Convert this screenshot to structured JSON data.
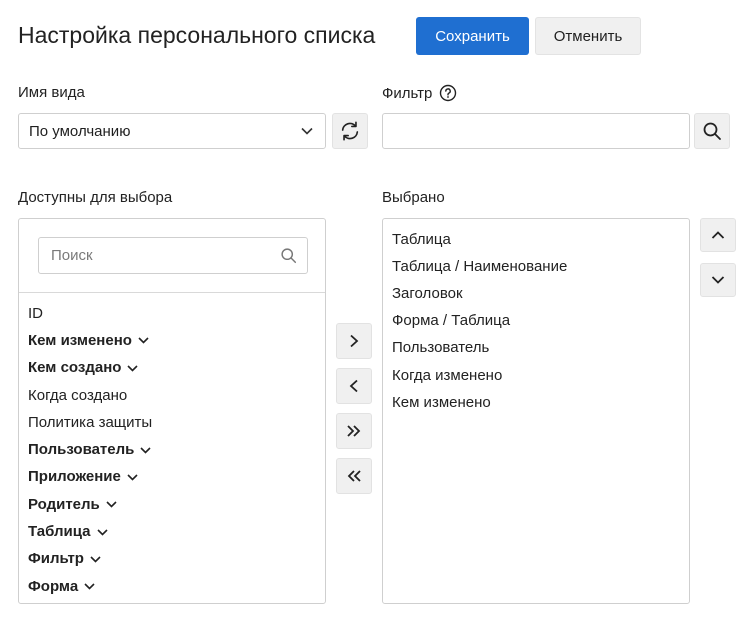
{
  "header": {
    "title": "Настройка персонального списка",
    "save_label": "Сохранить",
    "cancel_label": "Отменить"
  },
  "view": {
    "label": "Имя вида",
    "selected": "По умолчанию"
  },
  "filter": {
    "label": "Фильтр",
    "value": ""
  },
  "available": {
    "label": "Доступны для выбора",
    "search_placeholder": "Поиск",
    "items": [
      {
        "label": "ID",
        "expandable": false
      },
      {
        "label": "Кем изменено",
        "expandable": true
      },
      {
        "label": "Кем создано",
        "expandable": true
      },
      {
        "label": "Когда создано",
        "expandable": false
      },
      {
        "label": "Политика защиты",
        "expandable": false
      },
      {
        "label": "Пользователь",
        "expandable": true
      },
      {
        "label": "Приложение",
        "expandable": true
      },
      {
        "label": "Родитель",
        "expandable": true
      },
      {
        "label": "Таблица",
        "expandable": true
      },
      {
        "label": "Фильтр",
        "expandable": true
      },
      {
        "label": "Форма",
        "expandable": true
      }
    ]
  },
  "selected": {
    "label": "Выбрано",
    "items": [
      "Таблица",
      "Таблица / Наименование",
      "Заголовок",
      "Форма / Таблица",
      "Пользователь",
      "Когда изменено",
      "Кем изменено"
    ]
  },
  "icons": {
    "refresh": "refresh-icon",
    "search": "search-icon",
    "help": "help-circle-icon",
    "chevron_down": "chevron-down-icon",
    "chevron_up": "chevron-up-icon",
    "move_right": "chevron-right-icon",
    "move_left": "chevron-left-icon",
    "move_all_right": "double-chevron-right-icon",
    "move_all_left": "double-chevron-left-icon"
  },
  "colors": {
    "primary": "#1f6fd1",
    "button_bg": "#f0f0f0",
    "border": "#cfcfcf"
  }
}
